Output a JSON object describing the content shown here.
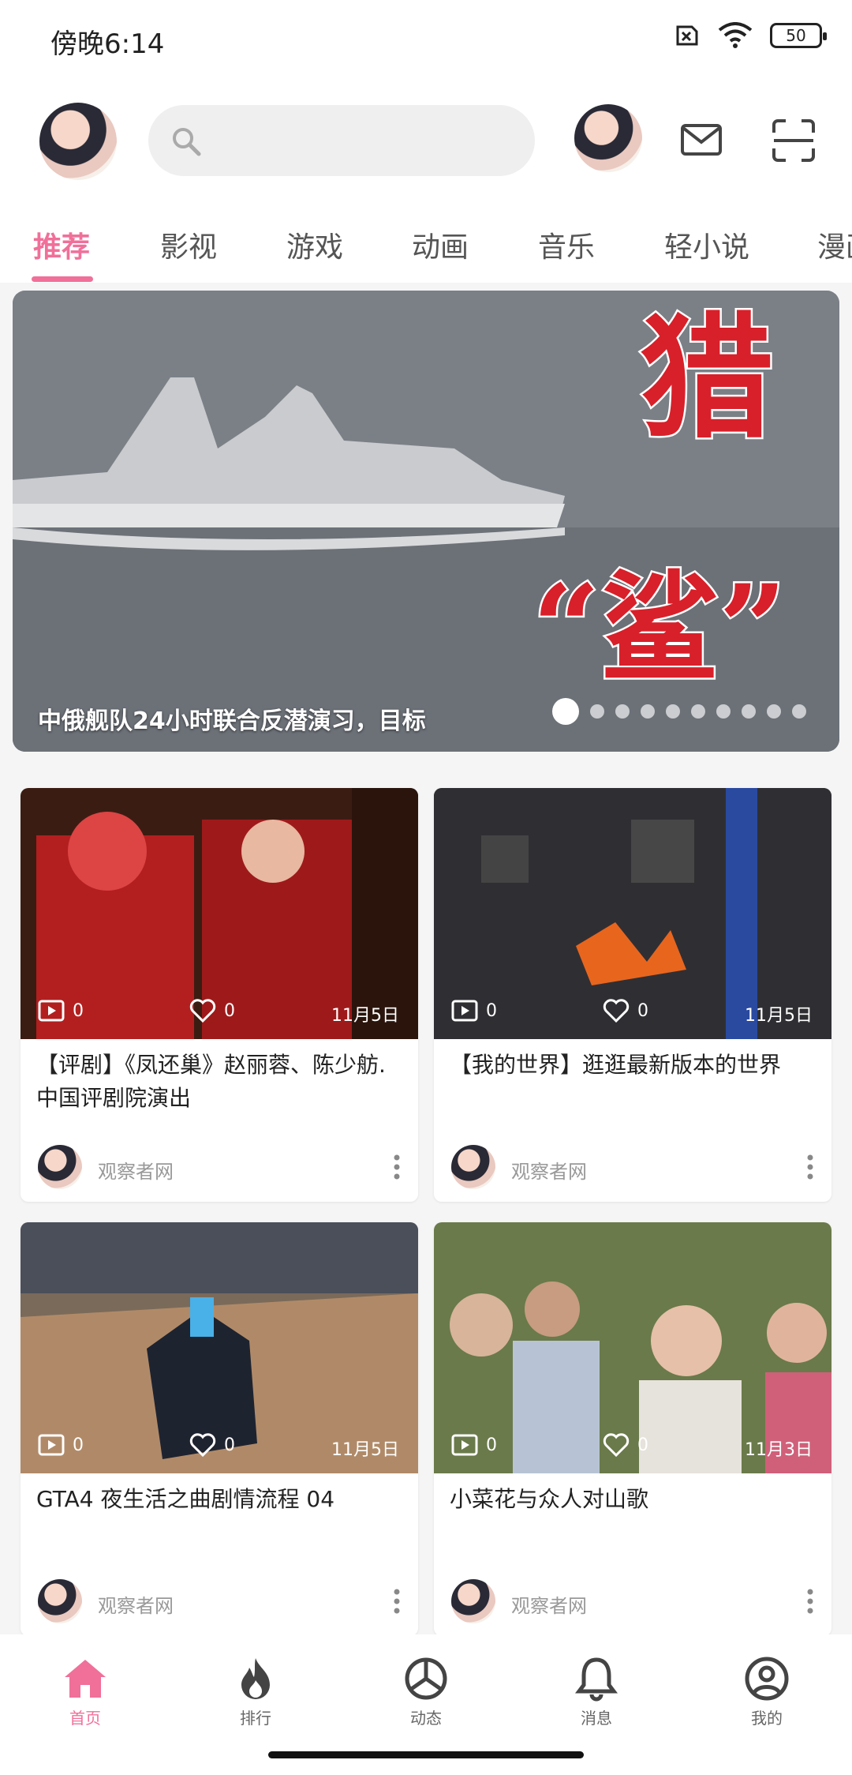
{
  "status_bar": {
    "time": "傍晚6:14",
    "battery": "50"
  },
  "header": {
    "search_placeholder": ""
  },
  "tabs": [
    {
      "label": "推荐",
      "active": true
    },
    {
      "label": "影视"
    },
    {
      "label": "游戏"
    },
    {
      "label": "动画"
    },
    {
      "label": "音乐"
    },
    {
      "label": "轻小说"
    },
    {
      "label": "漫画"
    }
  ],
  "banner": {
    "caption": "中俄舰队24小时联合反潜演习，目标",
    "overlay_text_1": "猎",
    "overlay_text_2": "“鲨”",
    "dot_count": 10,
    "active_dot": 0
  },
  "videos": [
    {
      "title": "【评剧】《凤还巢》赵丽蓉、陈少舫.中国评剧院演出",
      "plays": "0",
      "likes": "0",
      "date": "11月5日",
      "author": "观察者网"
    },
    {
      "title": "【我的世界】逛逛最新版本的世界",
      "plays": "0",
      "likes": "0",
      "date": "11月5日",
      "author": "观察者网"
    },
    {
      "title": "GTA4 夜生活之曲剧情流程 04",
      "plays": "0",
      "likes": "0",
      "date": "11月5日",
      "author": "观察者网"
    },
    {
      "title": "小菜花与众人对山歌",
      "plays": "0",
      "likes": "0",
      "date": "11月3日",
      "author": "观察者网"
    }
  ],
  "bottom_nav": [
    {
      "label": "首页",
      "icon": "home-icon",
      "active": true
    },
    {
      "label": "排行",
      "icon": "flame-icon"
    },
    {
      "label": "动态",
      "icon": "dynamic-icon"
    },
    {
      "label": "消息",
      "icon": "bell-icon"
    },
    {
      "label": "我的",
      "icon": "profile-icon"
    }
  ],
  "colors": {
    "accent": "#f0709a",
    "background": "#f5f5f5"
  }
}
